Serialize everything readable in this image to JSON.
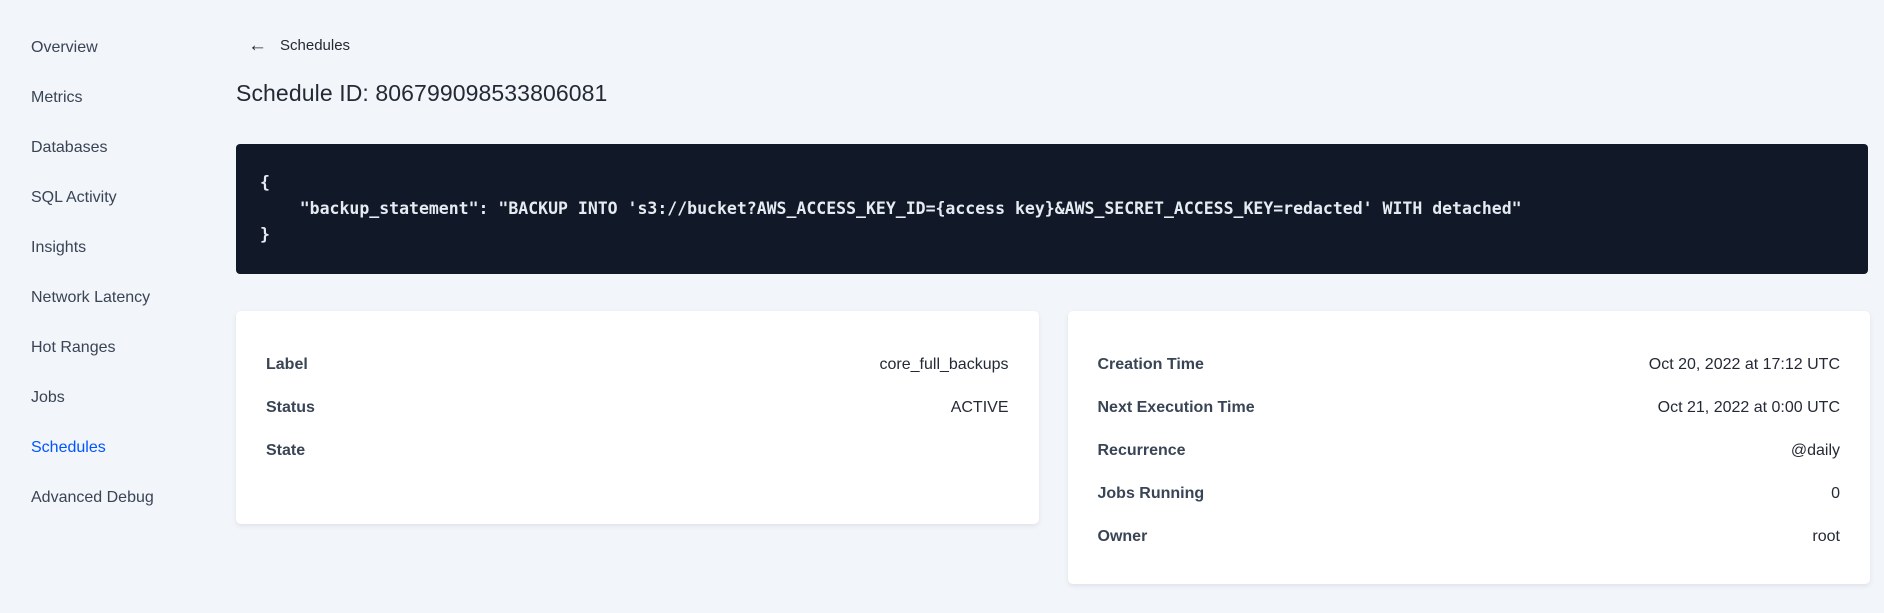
{
  "colors": {
    "page_background": "#f2f5f9",
    "card_background": "#ffffff",
    "code_background": "#111827",
    "code_text": "#e6ebf2",
    "text_primary": "#242a35",
    "text_label": "#394455",
    "accent_active_link": "#0055ff"
  },
  "sidebar": {
    "items": [
      {
        "label": "Overview",
        "active": false
      },
      {
        "label": "Metrics",
        "active": false
      },
      {
        "label": "Databases",
        "active": false
      },
      {
        "label": "SQL Activity",
        "active": false
      },
      {
        "label": "Insights",
        "active": false
      },
      {
        "label": "Network Latency",
        "active": false
      },
      {
        "label": "Hot Ranges",
        "active": false
      },
      {
        "label": "Jobs",
        "active": false
      },
      {
        "label": "Schedules",
        "active": true
      },
      {
        "label": "Advanced Debug",
        "active": false
      }
    ]
  },
  "header": {
    "back_icon": "←",
    "back_label": "Schedules",
    "title": "Schedule ID: 806799098533806081"
  },
  "code_block": {
    "lines": [
      "{",
      "    \"backup_statement\": \"BACKUP INTO 's3://bucket?AWS_ACCESS_KEY_ID={access key}&AWS_SECRET_ACCESS_KEY=redacted' WITH detached\"",
      "}"
    ]
  },
  "details_left": {
    "rows": [
      {
        "label": "Label",
        "value": "core_full_backups"
      },
      {
        "label": "Status",
        "value": "ACTIVE"
      },
      {
        "label": "State",
        "value": ""
      }
    ]
  },
  "details_right": {
    "rows": [
      {
        "label": "Creation Time",
        "value": "Oct 20, 2022 at 17:12 UTC"
      },
      {
        "label": "Next Execution Time",
        "value": "Oct 21, 2022 at 0:00 UTC"
      },
      {
        "label": "Recurrence",
        "value": "@daily"
      },
      {
        "label": "Jobs Running",
        "value": "0"
      },
      {
        "label": "Owner",
        "value": "root"
      }
    ]
  }
}
